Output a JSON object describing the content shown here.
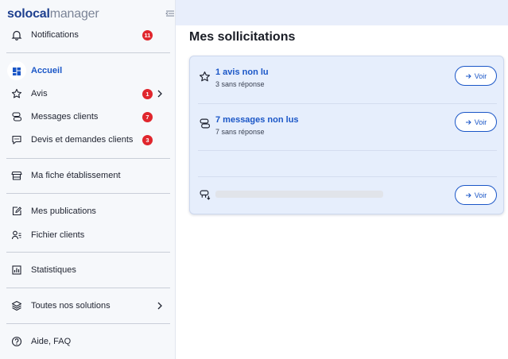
{
  "app": {
    "brand_part": "solocal",
    "product_part": "manager"
  },
  "sidebar": {
    "notifications": {
      "label": "Notifications",
      "badge": "11"
    },
    "accueil": {
      "label": "Accueil"
    },
    "avis": {
      "label": "Avis",
      "badge": "1"
    },
    "messages": {
      "label": "Messages clients",
      "badge": "7"
    },
    "devis": {
      "label": "Devis et demandes clients",
      "badge": "3"
    },
    "fiche": {
      "label": "Ma fiche établissement"
    },
    "publications": {
      "label": "Mes publications"
    },
    "fichier": {
      "label": "Fichier clients"
    },
    "statistiques": {
      "label": "Statistiques"
    },
    "solutions": {
      "label": "Toutes nos solutions"
    },
    "aide": {
      "label": "Aide, FAQ"
    }
  },
  "main": {
    "title": "Mes sollicitations",
    "rows": [
      {
        "title": "1 avis non lu",
        "subtitle": "3 sans réponse",
        "button": "Voir"
      },
      {
        "title": "7 messages non lus",
        "subtitle": "7 sans réponse",
        "button": "Voir"
      },
      {
        "title": "",
        "subtitle": "",
        "button": "Voir"
      }
    ]
  },
  "colors": {
    "accent": "#1a56c7",
    "badge": "#e0262d",
    "card_bg": "#e6eefc",
    "sidebar_bg": "#f6f8fb"
  },
  "icons": [
    "bell-icon",
    "dashboard-icon",
    "star-icon",
    "chat-icon",
    "comment-icon",
    "store-icon",
    "edit-icon",
    "users-icon",
    "chart-icon",
    "layers-icon",
    "help-icon",
    "chevron-right-icon",
    "collapse-icon",
    "arrow-right-icon",
    "quote-icon"
  ]
}
